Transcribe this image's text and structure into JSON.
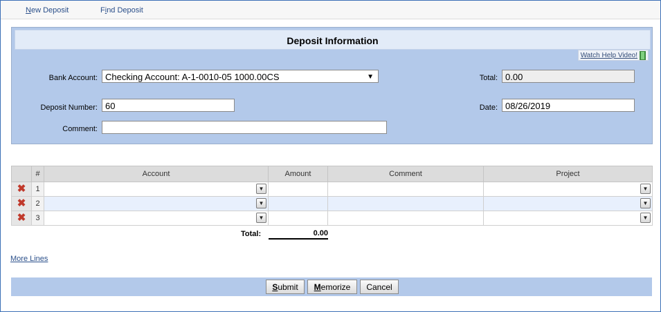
{
  "nav": {
    "new_deposit": "New Deposit",
    "find_deposit": "Find Deposit"
  },
  "panel": {
    "title": "Deposit Information",
    "help_video": "Watch Help Video!",
    "bank_account_label": "Bank Account:",
    "bank_account_value": "Checking Account: A-1-0010-05 1000.00CS",
    "deposit_number_label": "Deposit Number:",
    "deposit_number_value": "60",
    "comment_label": "Comment:",
    "comment_value": "",
    "total_label": "Total:",
    "total_value": "0.00",
    "date_label": "Date:",
    "date_value": "08/26/2019"
  },
  "grid": {
    "columns": [
      "#",
      "Account",
      "Amount",
      "Comment",
      "Project"
    ],
    "rows": [
      {
        "num": "1",
        "account": "",
        "amount": "",
        "comment": "",
        "project": ""
      },
      {
        "num": "2",
        "account": "",
        "amount": "",
        "comment": "",
        "project": ""
      },
      {
        "num": "3",
        "account": "",
        "amount": "",
        "comment": "",
        "project": ""
      }
    ],
    "total_label": "Total:",
    "total_value": "0.00"
  },
  "more_lines": "More Lines",
  "buttons": {
    "submit": "Submit",
    "memorize": "Memorize",
    "cancel": "Cancel"
  },
  "icons": {
    "delete": "delete-x-icon",
    "dropdown": "chevron-down-icon",
    "video": "film-icon"
  },
  "colors": {
    "panel_bg": "#b3c9ea",
    "link": "#2a4f8a",
    "delete": "#c0392b"
  }
}
